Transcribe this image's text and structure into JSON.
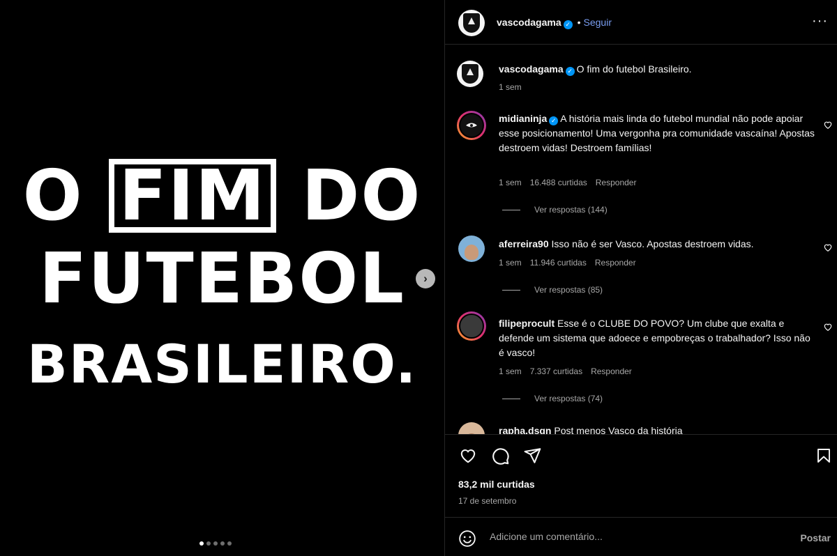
{
  "media": {
    "headline": {
      "word1": "O",
      "word_boxed": "FIM",
      "word3": "DO",
      "line2": "FUTEBOL",
      "line3": "BRASILEIRO."
    },
    "next_icon": "chevron-right-icon",
    "carousel_dots": 5,
    "carousel_active": 1
  },
  "header": {
    "username": "vascodagama",
    "separator": "•",
    "follow_label": "Seguir",
    "more_icon": "ellipsis-icon"
  },
  "caption": {
    "username": "vascodagama",
    "text": "O fim do futebol Brasileiro.",
    "time": "1 sem"
  },
  "comments": [
    {
      "username": "midianinja",
      "verified": true,
      "text": "A história mais linda do futebol mundial não pode apoiar esse posicionamento! Uma vergonha pra comunidade vascaína! Apostas destroem vidas! Destroem famílias!",
      "time": "1 sem",
      "likes": "16.488 curtidas",
      "reply_label": "Responder",
      "view_replies": "Ver respostas (144)"
    },
    {
      "username": "aferreira90",
      "verified": false,
      "text": "Isso não é ser Vasco. Apostas destroem vidas.",
      "time": "1 sem",
      "likes": "11.946 curtidas",
      "reply_label": "Responder",
      "view_replies": "Ver respostas (85)"
    },
    {
      "username": "filipeprocult",
      "verified": false,
      "text": "Esse é o CLUBE DO POVO? Um clube que exalta e defende um sistema que adoece e empobreças o trabalhador? Isso não é vasco!",
      "time": "1 sem",
      "likes": "7.337 curtidas",
      "reply_label": "Responder",
      "view_replies": "Ver respostas (74)"
    },
    {
      "username": "rapha.dsgn",
      "verified": false,
      "text": "Post menos Vasco da história"
    }
  ],
  "actions": {
    "icons": [
      "heart-icon",
      "comment-icon",
      "share-icon",
      "bookmark-icon"
    ],
    "likes": "83,2 mil curtidas",
    "date": "17 de setembro"
  },
  "compose": {
    "placeholder": "Adicione um comentário...",
    "post_label": "Postar",
    "emoji_icon": "emoji-icon"
  },
  "colors": {
    "background": "#000000",
    "link_blue": "#7a9ef2",
    "verified_blue": "#0095f6",
    "muted_text": "#a8a8a8"
  }
}
